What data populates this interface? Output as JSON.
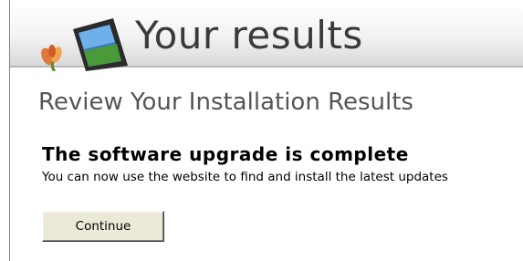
{
  "banner": {
    "title": "Your results",
    "logo_icon": "windows-tablet-icon"
  },
  "main": {
    "subtitle": "Review Your Installation Results",
    "heading": "The software upgrade is complete",
    "description": "You can now use the website to find and install the latest updates",
    "continue_label": "Continue"
  },
  "colors": {
    "title_text": "#3a3a3a",
    "subtitle_text": "#555555",
    "button_face": "#ece9d8"
  }
}
